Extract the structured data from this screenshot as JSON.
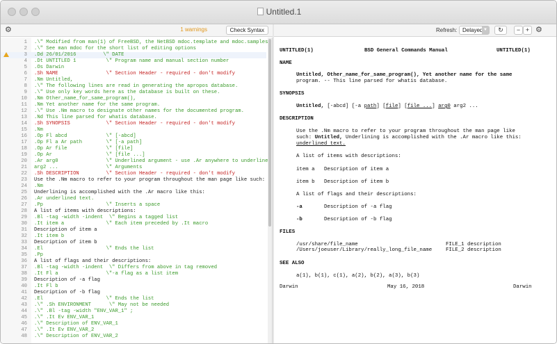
{
  "window": {
    "title": "Untitled.1"
  },
  "editor_toolbar": {
    "warnings": "1 warnings",
    "check_syntax": "Check Syntax"
  },
  "preview_toolbar": {
    "refresh_label": "Refresh:",
    "refresh_value": "Delayed"
  },
  "editor": {
    "lines": [
      {
        "n": "1",
        "t": ".\\\" Modified from man(1) of FreeBSD, the NetBSD mdoc.template and mdoc.samples.",
        "k": "c"
      },
      {
        "n": "2",
        "t": ".\\\" See man mdoc for the short list of editing options",
        "k": "c"
      },
      {
        "n": "3",
        "t": ".Dd 26/01/2016         \\\" DATE",
        "k": "c",
        "warn": true,
        "hl": true
      },
      {
        "n": "4",
        "t": ".Dt UNTITLED 1          \\\" Program name and manual section number",
        "k": "c"
      },
      {
        "n": "5",
        "t": ".Os Darwin",
        "k": "c"
      },
      {
        "n": "6",
        "t": ".Sh NAME                \\\" Section Header - required - don't modify",
        "k": "m"
      },
      {
        "n": "7",
        "t": ".Nm Untitled,",
        "k": "c"
      },
      {
        "n": "8",
        "t": ".\\\" The following lines are read in generating the apropos database.",
        "k": "c"
      },
      {
        "n": "9",
        "t": ".\\\" Use only key words here as the database is built on these.",
        "k": "c"
      },
      {
        "n": "10",
        "t": ".Nm Other_name_for_same_program(),",
        "k": "c"
      },
      {
        "n": "11",
        "t": ".Nm Yet another name for the same program.",
        "k": "c"
      },
      {
        "n": "12",
        "t": ".\\\" Use .Nm macro to designate other names for the documented program.",
        "k": "c"
      },
      {
        "n": "13",
        "t": ".Nd This line parsed for whatis database.",
        "k": "c"
      },
      {
        "n": "14",
        "t": ".Sh SYNOPSIS            \\\" Section Header - required - don't modify",
        "k": "m"
      },
      {
        "n": "15",
        "t": ".Nm",
        "k": "c"
      },
      {
        "n": "16",
        "t": ".Op Fl abcd             \\\" [-abcd]",
        "k": "c"
      },
      {
        "n": "17",
        "t": ".Op Fl a Ar path        \\\" [-a path]",
        "k": "c"
      },
      {
        "n": "18",
        "t": ".Op Ar file             \\\" [file]",
        "k": "c"
      },
      {
        "n": "19",
        "t": ".Op Ar                  \\\" [file ...]",
        "k": "c"
      },
      {
        "n": "20",
        "t": ".Ar arg0                \\\" Underlined argument - use .Ar anywhere to underline",
        "k": "c"
      },
      {
        "n": "21",
        "t": "arg2 ...                \\\" Arguments",
        "k": "c"
      },
      {
        "n": "22",
        "t": ".Sh DESCRIPTION         \\\" Section Header - required - don't modify",
        "k": "m"
      },
      {
        "n": "23",
        "t": "Use the .Nm macro to refer to your program throughout the man page like such:",
        "k": ""
      },
      {
        "n": "24",
        "t": ".Nm",
        "k": "c"
      },
      {
        "n": "25",
        "t": "Underlining is accomplished with the .Ar macro like this:",
        "k": ""
      },
      {
        "n": "26",
        "t": ".Ar underlined text.",
        "k": "c"
      },
      {
        "n": "27",
        "t": ".Pp                     \\\" Inserts a space",
        "k": "c"
      },
      {
        "n": "28",
        "t": "A list of items with descriptions:",
        "k": ""
      },
      {
        "n": "29",
        "t": ".Bl -tag -width -indent  \\\" Begins a tagged list",
        "k": "c"
      },
      {
        "n": "30",
        "t": ".It item a              \\\" Each item preceded by .It macro",
        "k": "c"
      },
      {
        "n": "31",
        "t": "Description of item a",
        "k": ""
      },
      {
        "n": "32",
        "t": ".It item b",
        "k": "c"
      },
      {
        "n": "33",
        "t": "Description of item b",
        "k": ""
      },
      {
        "n": "34",
        "t": ".El                     \\\" Ends the list",
        "k": "c"
      },
      {
        "n": "35",
        "t": ".Pp",
        "k": "c"
      },
      {
        "n": "36",
        "t": "A list of flags and their descriptions:",
        "k": ""
      },
      {
        "n": "37",
        "t": ".Bl -tag -width -indent  \\\" Differs from above in tag removed",
        "k": "c"
      },
      {
        "n": "38",
        "t": ".It Fl a                \\\"-a flag as a list item",
        "k": "c"
      },
      {
        "n": "39",
        "t": "Description of -a flag",
        "k": ""
      },
      {
        "n": "40",
        "t": ".It Fl b",
        "k": "c"
      },
      {
        "n": "41",
        "t": "Description of -b flag",
        "k": ""
      },
      {
        "n": "42",
        "t": ".El                     \\\" Ends the list",
        "k": "c"
      },
      {
        "n": "43",
        "t": ".\\\" .Sh ENVIRONMENT      \\\" May not be needed",
        "k": "c"
      },
      {
        "n": "44",
        "t": ".\\\" .Bl -tag -width \"ENV_VAR_1\" ;",
        "k": "c"
      },
      {
        "n": "45",
        "t": ".\\\" .It Ev ENV_VAR_1",
        "k": "c"
      },
      {
        "n": "46",
        "t": ".\\\" Description of ENV_VAR_1",
        "k": "c"
      },
      {
        "n": "47",
        "t": ".\\\" .It Ev ENV_VAR_2",
        "k": "c"
      },
      {
        "n": "48",
        "t": ".\\\" Description of ENV_VAR_2",
        "k": "c"
      }
    ]
  },
  "preview": {
    "header_left": "UNTITLED(1)",
    "header_center": "BSD General Commands Manual",
    "header_right": "UNTITLED(1)",
    "name_heading": "NAME",
    "name_line1": "Untitled, Other_name_for_same_program(), Yet another name for the same",
    "name_line2": "program. -- This line parsed for whatis database.",
    "synopsis_heading": "SYNOPSIS",
    "synopsis_prog": "Untitled,",
    "synopsis_opt1": "[-abcd]",
    "synopsis_opt2": "[-a",
    "synopsis_opt2b": "path",
    "synopsis_opt2c": "]",
    "synopsis_opt3a": "[",
    "synopsis_opt3": "file",
    "synopsis_opt3b": "]",
    "synopsis_opt4a": "[",
    "synopsis_opt4": "file ...",
    "synopsis_opt4b": "]",
    "synopsis_arg0": "arg0",
    "synopsis_arg2": "arg2 ...",
    "description_heading": "DESCRIPTION",
    "desc_line1": "Use the .Nm macro to refer to your program throughout the man page like",
    "desc_line2a": "such:",
    "desc_line2b": "Untitled,",
    "desc_line2c": "Underlining is accomplished with the .Ar macro like this:",
    "desc_line3": "underlined text.",
    "items_intro": "A list of items with descriptions:",
    "item_a_tag": "item a",
    "item_a_desc": "Description of item a",
    "item_b_tag": "item b",
    "item_b_desc": "Description of item b",
    "flags_intro": "A list of flags and their descriptions:",
    "flag_a_tag": "-a",
    "flag_a_desc": "Description of -a flag",
    "flag_b_tag": "-b",
    "flag_b_desc": "Description of -b flag",
    "files_heading": "FILES",
    "file1_path": "/usr/share/file_name",
    "file1_desc": "FILE_1 description",
    "file2_path": "/Users/joeuser/Library/really_long_file_name",
    "file2_desc": "FILE_2 description",
    "see_also_heading": "SEE ALSO",
    "see_also_list": "a(1), b(1), c(1), a(2), b(2), a(3), b(3)",
    "footer_left": "Darwin",
    "footer_center": "May 16, 2018",
    "footer_right": "Darwin"
  }
}
